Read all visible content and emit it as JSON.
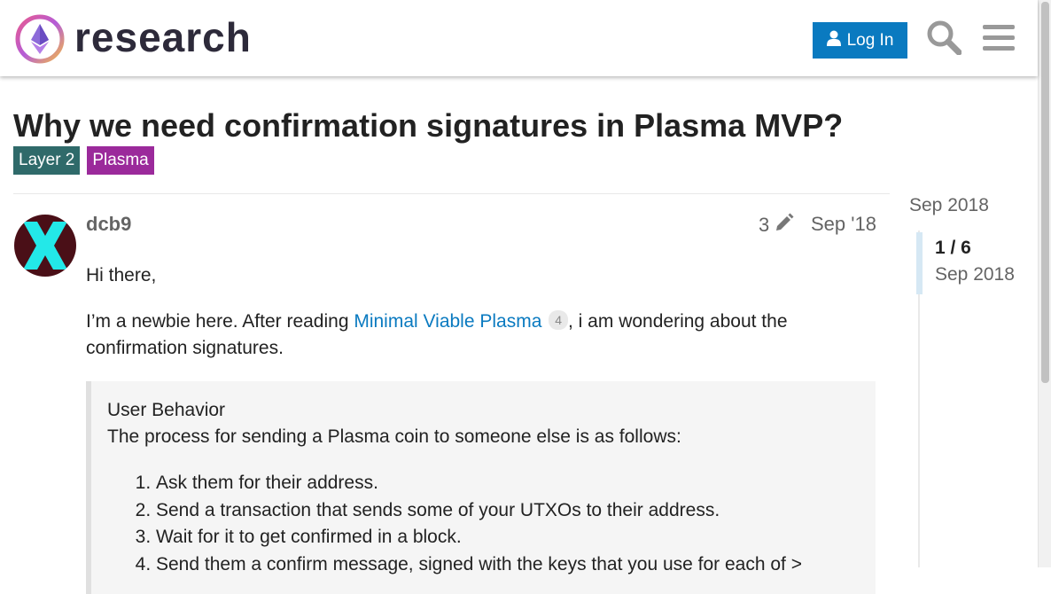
{
  "header": {
    "brand": "research",
    "login_label": "Log In",
    "icons": [
      "user-icon",
      "search-icon",
      "hamburger-menu-icon"
    ],
    "accent": "#0a7ac0"
  },
  "topic": {
    "title": "Why we need confirmation signatures in Plasma MVP?",
    "tags": [
      {
        "label": "Layer 2",
        "color": "#2f6a6a"
      },
      {
        "label": "Plasma",
        "color": "#9b2a9b"
      }
    ]
  },
  "post": {
    "username": "dcb9",
    "edit_count": "3",
    "date": "Sep '18",
    "greeting": "Hi there,",
    "intro_before": "I’m a newbie here. After reading ",
    "link_text": "Minimal Viable Plasma",
    "link_clicks": "4",
    "intro_after": ", i am wondering about the confirmation signatures.",
    "quote": {
      "heading": "User Behavior",
      "lead": "The process for sending a Plasma coin to someone else is as follows:",
      "steps": [
        "Ask them for their address.",
        "Send a transaction that sends some of your UTXOs to their address.",
        "Wait for it to get confirmed in a block.",
        "Send them a confirm message, signed with the keys that you use for each of >"
      ]
    }
  },
  "timeline": {
    "top_date": "Sep 2018",
    "position": "1 / 6",
    "current_date": "Sep 2018"
  }
}
